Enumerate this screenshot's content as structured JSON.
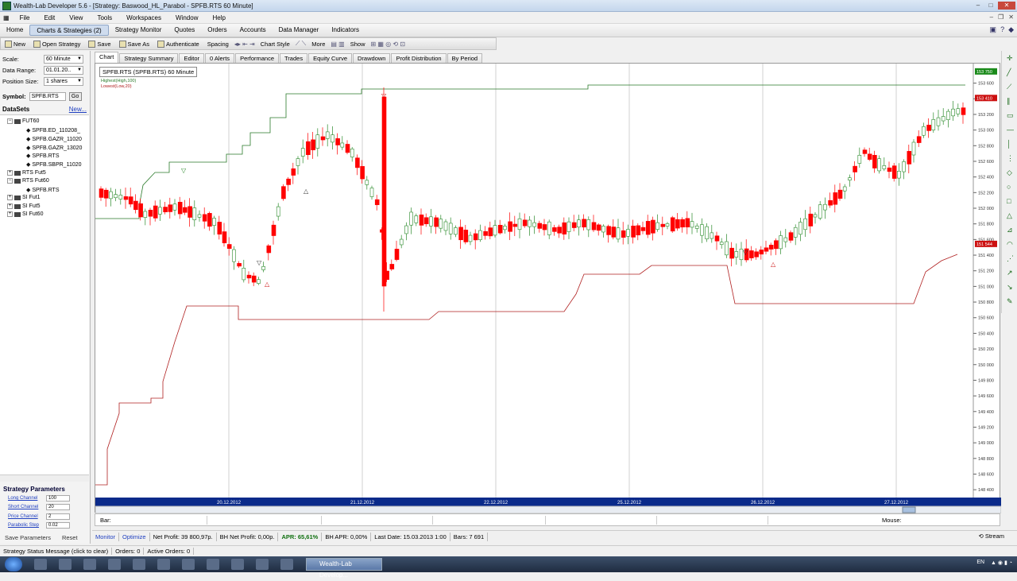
{
  "window": {
    "title": "Wealth-Lab Developer 5.6 - [Strategy: Baswood_HL_Parabol - SPFB.RTS 60 Minute]"
  },
  "menu": [
    "File",
    "Edit",
    "View",
    "Tools",
    "Workspaces",
    "Window",
    "Help"
  ],
  "nav": [
    "Home",
    "Charts & Strategies (2)",
    "Strategy Monitor",
    "Quotes",
    "Orders",
    "Accounts",
    "Data Manager",
    "Indicators"
  ],
  "toolbar": {
    "new": "New",
    "open": "Open Strategy",
    "save": "Save",
    "save_as": "Save As",
    "authenticate": "Authenticate",
    "spacing": "Spacing",
    "chart_style": "Chart Style",
    "more": "More",
    "show": "Show"
  },
  "params": {
    "scale_label": "Scale:",
    "scale_value": "60 Minute",
    "range_label": "Data Range:",
    "range_value": "01.01.20..",
    "pos_label": "Position Size:",
    "pos_value": "1 shares",
    "symbol_label": "Symbol:",
    "symbol_value": "SPFB.RTS",
    "go": "Go"
  },
  "datasets": {
    "title": "DataSets",
    "new": "New...",
    "nodes": [
      "FUT60",
      "SPFB.ED_110208_",
      "SPFB.GAZR_11020",
      "SPFB.GAZR_13020",
      "SPFB.RTS",
      "SPFB.SBPR_11020",
      "RTS Fut5",
      "RTS Fut60",
      "SPFB.RTS",
      "SI Fut1",
      "SI Fut5",
      "SI Fut60"
    ]
  },
  "strategy_params": {
    "title": "Strategy Parameters",
    "items": [
      {
        "label": "Long Channel",
        "value": "100"
      },
      {
        "label": "Short Channel",
        "value": "20"
      },
      {
        "label": "Price Channel",
        "value": "2"
      },
      {
        "label": "Parabolic Step",
        "value": "0.02"
      }
    ],
    "save": "Save Parameters",
    "reset": "Reset"
  },
  "tabs": [
    "Chart",
    "Strategy Summary",
    "Editor",
    "0 Alerts",
    "Performance",
    "Trades",
    "Equity Curve",
    "Drawdown",
    "Profit Distribution",
    "By Period"
  ],
  "chart_overlay": {
    "symbol": "SPFB.RTS (SPFB.RTS) 60 Minute",
    "ind1": "Highest(High,100)",
    "ind2": "Lowest(Low,20)"
  },
  "chart_data": {
    "type": "candlestick",
    "price_range": [
      148300,
      153850
    ],
    "price_ticks": [
      148400,
      148600,
      148800,
      149000,
      149200,
      149400,
      149600,
      149800,
      150000,
      150200,
      150400,
      150600,
      150800,
      151000,
      151200,
      151400,
      151600,
      151800,
      152000,
      152200,
      152400,
      152600,
      152800,
      153000,
      153200,
      153400,
      153600
    ],
    "price_labels": [
      "148 400",
      "148 600",
      "148 800",
      "149 000",
      "149 200",
      "149 400",
      "149 600",
      "149 800",
      "150 000",
      "150 200",
      "150 400",
      "150 600",
      "150 800",
      "151 000",
      "151 200",
      "151 400",
      "151 600",
      "151 800",
      "152 000",
      "152 200",
      "152 400",
      "152 600",
      "152 800",
      "153 000",
      "153 200",
      "153 400",
      "153 600"
    ],
    "date_labels": [
      "20.12.2012",
      "21.12.2012",
      "22.12.2012",
      "25.12.2012",
      "26.12.2012",
      "27.12.2012"
    ],
    "badges": [
      {
        "text": "153 750",
        "color": "#1a8a1a",
        "value": 153750
      },
      {
        "text": "153 410",
        "color": "#cc1010",
        "value": 153410
      },
      {
        "text": "151 544",
        "color": "#cc1010",
        "value": 151544
      }
    ],
    "up_color": "#2a8a2a",
    "down_color": "#ff0000",
    "highest_color": "#2a7a2a",
    "lowest_color": "#b02020"
  },
  "barline": {
    "bar": "Bar:",
    "mouse": "Mouse:"
  },
  "status": {
    "monitor": "Monitor",
    "optimize": "Optimize",
    "net_profit": "Net Profit: 39 800,97p.",
    "bh_net": "BH Net Profit: 0,00p.",
    "apr": "APR: 65,61%",
    "bh_apr": "BH APR: 0,00%",
    "last_date": "Last Date: 15.03.2013 1:00",
    "bars": "Bars: 7 691",
    "stream": "Stream"
  },
  "bottom": {
    "msg": "Strategy Status Message (click to clear)",
    "orders": "Orders: 0",
    "active": "Active Orders: 0"
  },
  "taskbar": {
    "active": "Wealth-Lab Develop...",
    "lang": "EN"
  }
}
